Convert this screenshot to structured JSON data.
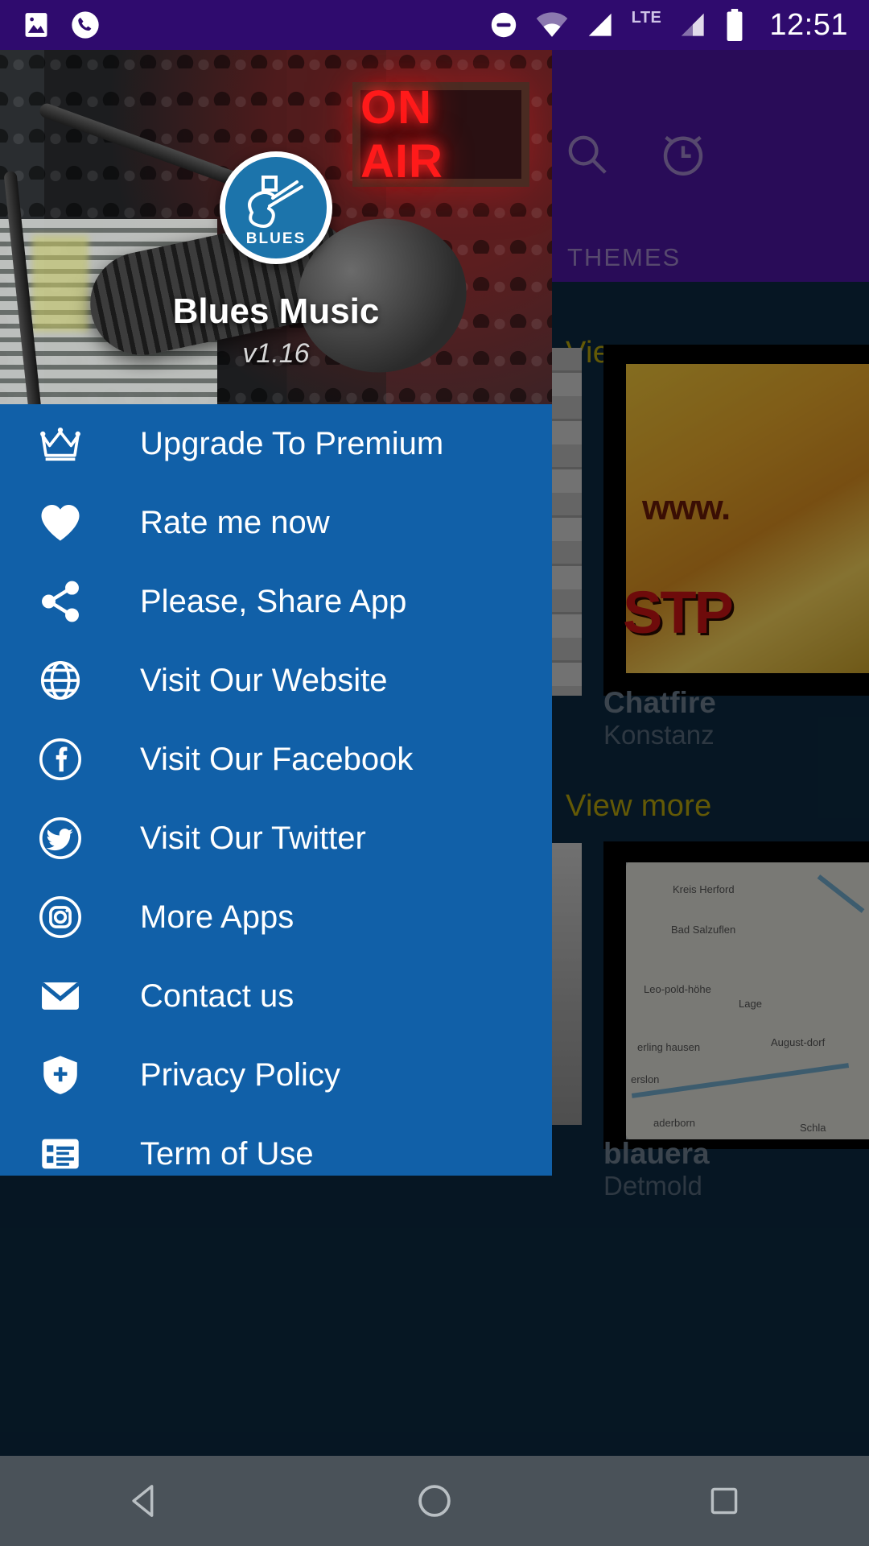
{
  "status_bar": {
    "time": "12:51",
    "left_icons": [
      "image-icon",
      "phone-call-icon"
    ],
    "right_icons": [
      "do-not-disturb-icon",
      "wifi-icon",
      "signal-icon",
      "lte-icon",
      "signal-2-icon",
      "battery-icon"
    ],
    "lte_label": "LTE"
  },
  "background_app": {
    "actions": [
      "search-icon",
      "alarm-icon"
    ],
    "tab_label": "THEMES",
    "view_more_1": "View more",
    "view_more_2": "View more",
    "cards": [
      {
        "title": "Chatfire",
        "subtitle": "Konstanz",
        "art_www": "www.",
        "art_stp": "STP"
      },
      {
        "title": "blauera",
        "subtitle": "Detmold",
        "map_labels": [
          "Kreis Herford",
          "Bad Salzuflen",
          "Leo-pold-höhe",
          "Lage",
          "August-dorf",
          "erling hausen",
          "erslon",
          "aderborn",
          "Schla"
        ]
      }
    ]
  },
  "drawer": {
    "logo_text": "BLUES",
    "app_title": "Blues Music",
    "app_version": "v1.16",
    "on_air_sign": "ON AIR",
    "items": [
      {
        "label": "Upgrade To Premium",
        "icon": "crown-icon"
      },
      {
        "label": "Rate me now",
        "icon": "heart-icon"
      },
      {
        "label": "Please, Share App",
        "icon": "share-icon"
      },
      {
        "label": "Visit Our Website",
        "icon": "globe-icon"
      },
      {
        "label": "Visit Our Facebook",
        "icon": "facebook-icon"
      },
      {
        "label": "Visit Our Twitter",
        "icon": "twitter-icon"
      },
      {
        "label": "More Apps",
        "icon": "instagram-icon"
      },
      {
        "label": "Contact us",
        "icon": "envelope-icon"
      },
      {
        "label": "Privacy Policy",
        "icon": "shield-icon"
      },
      {
        "label": "Term of Use",
        "icon": "list-icon"
      }
    ]
  },
  "nav_bar": {
    "back": "back-icon",
    "home": "home-icon",
    "recents": "recents-icon"
  },
  "colors": {
    "status_bar": "#2F0B6E",
    "app_bar": "#4B16A0",
    "drawer": "#1160A8",
    "content_bg": "#0B2940",
    "accent_yellow": "#B5A30B",
    "nav_bar": "#4A5259"
  }
}
